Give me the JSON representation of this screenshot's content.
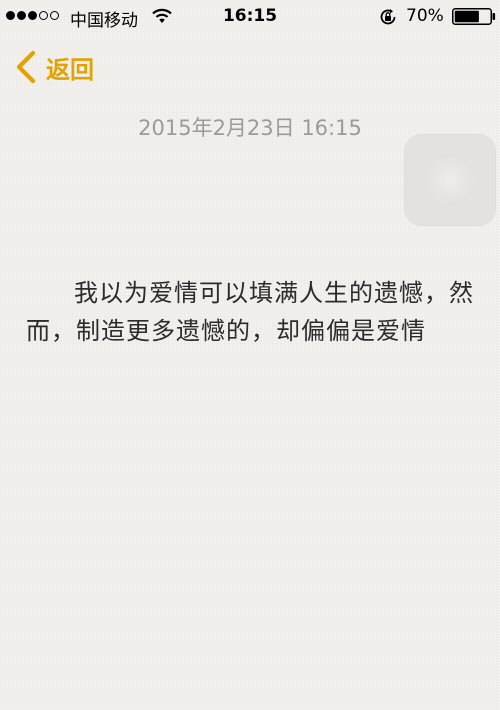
{
  "status_bar": {
    "signal_dots_filled": 3,
    "signal_dots_total": 5,
    "carrier": "中国移动",
    "time": "16:15",
    "battery_percent": "70%",
    "battery_level": 0.7,
    "icons": [
      "signal-dots-icon",
      "wifi-icon",
      "rotation-lock-icon",
      "battery-icon"
    ]
  },
  "nav": {
    "back_label": "返回",
    "accent_color": "#e3a200"
  },
  "note": {
    "date": "2015年2月23日 16:15",
    "body": "我以为爱情可以填满人生的遗憾，然而，制造更多遗憾的，却偏偏是爱情"
  }
}
